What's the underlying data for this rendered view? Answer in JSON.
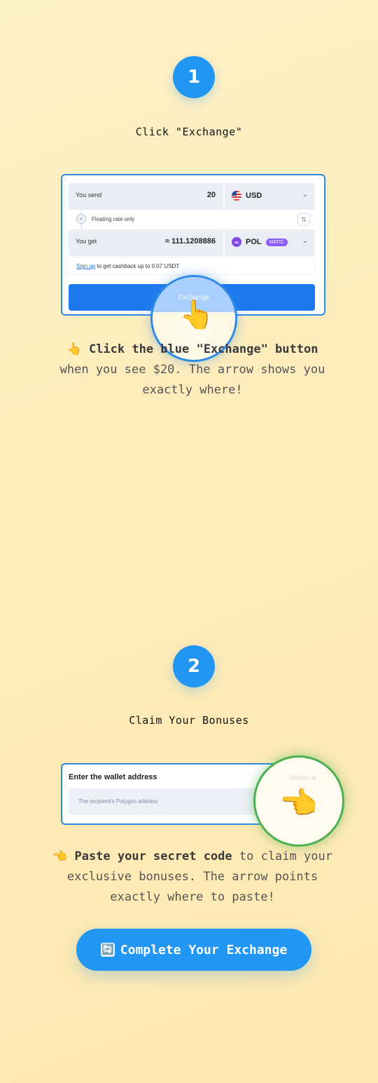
{
  "step1": {
    "number": "1",
    "title": "Click \"Exchange\"",
    "widget": {
      "send_label": "You send",
      "send_amount": "20",
      "send_currency": "USD",
      "floating_label": "Floating rate only",
      "get_label": "You get",
      "get_amount": "≈ 111.1208886",
      "get_currency": "POL",
      "get_badge": "MATIC",
      "signup_link": "Sign up",
      "signup_text": " to get cashback up to 0.07 USDT",
      "exchange_button": "Exchange"
    },
    "caption": {
      "emoji": "👆",
      "bold": "Click the blue \"Exchange\" button",
      "rest": " when you see $20. The arrow shows you exactly where!"
    }
  },
  "step2": {
    "number": "2",
    "title": "Claim Your Bonuses",
    "widget": {
      "title": "Enter the wallet address",
      "wallets_label": "Wallets ⊕",
      "placeholder": "The recipient's Polygon address"
    },
    "caption": {
      "emoji": "👈",
      "bold": "Paste your secret code",
      "rest": " to claim your exclusive bonuses. The arrow points exactly where to paste!"
    }
  },
  "cta": {
    "icon": "🔄",
    "label": "Complete Your Exchange"
  },
  "colors": {
    "accent": "#2196f3",
    "highlight_blue": "#2e8ae6",
    "highlight_green": "#4caf50",
    "background": "#fdefc0"
  }
}
